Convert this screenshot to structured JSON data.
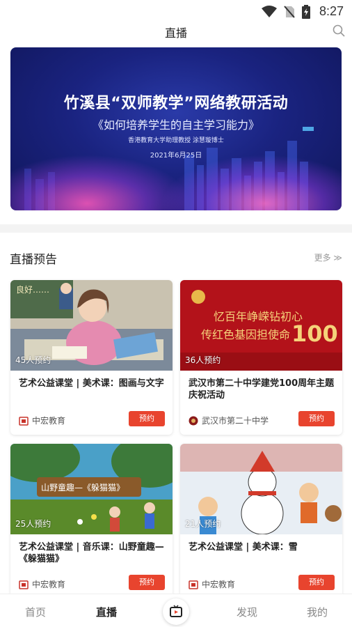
{
  "status": {
    "time": "8:27"
  },
  "header": {
    "title": "直播"
  },
  "banner": {
    "title": "竹溪县“双师教学”网络教研活动",
    "subtitle": "《如何培养学生的自主学习能力》",
    "speaker": "香港教育大学助理教授  涂慧璇博士",
    "date": "2021年6月25日"
  },
  "section": {
    "title": "直播预告",
    "more": "更多 ≫"
  },
  "cards": [
    {
      "count": "45人预约",
      "title": "艺术公益课堂 | 美术课：图画与文字",
      "org": "中宏教育",
      "button": "预约"
    },
    {
      "count": "36人预约",
      "title": "武汉市第二十中学建党100周年主题庆祝活动",
      "org": "武汉市第二十中学",
      "button": "预约"
    },
    {
      "count": "25人预约",
      "title": "艺术公益课堂 | 音乐课：山野童趣—《躲猫猫》",
      "org": "中宏教育",
      "button": "预约"
    },
    {
      "count": "21人预约",
      "title": "艺术公益课堂 | 美术课：雪",
      "org": "中宏教育",
      "button": "预约"
    }
  ],
  "thumb_text": {
    "card2_line1": "忆百年峥嵘钻初心",
    "card2_line2": "传红色基因担使命",
    "card2_num": "100",
    "card3_sign": "山野童趣—《躲猫猫》",
    "card1_board": "良好……"
  },
  "tabs": {
    "home": "首页",
    "live": "直播",
    "discover": "发现",
    "mine": "我的"
  },
  "colors": {
    "accent": "#e8442e",
    "banner": "#1a2380"
  }
}
